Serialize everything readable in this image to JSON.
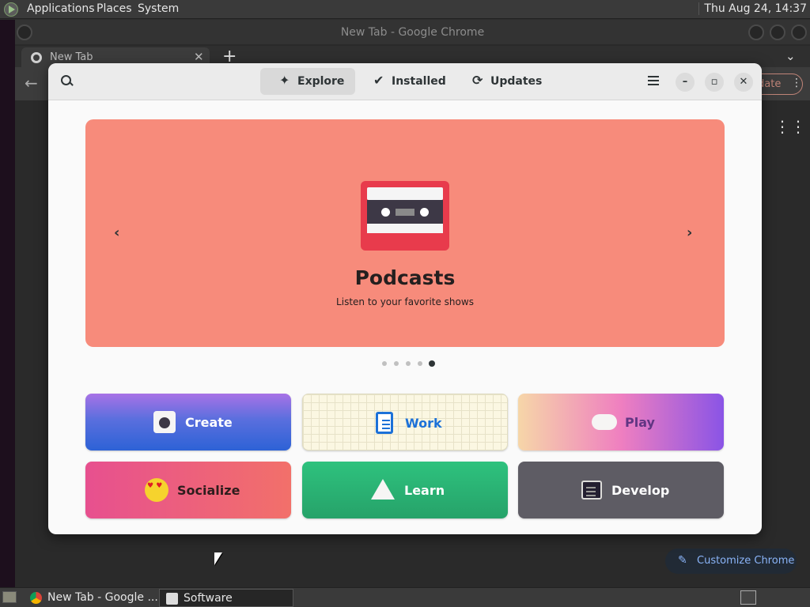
{
  "top_panel": {
    "menus": [
      "Applications",
      "Places",
      "System"
    ],
    "clock": "Thu Aug 24, 14:37"
  },
  "chrome": {
    "window_title": "New Tab - Google Chrome",
    "tab_label": "New Tab",
    "update_label": "date",
    "customize_label": "Customize Chrome"
  },
  "software": {
    "tabs": {
      "explore": "Explore",
      "installed": "Installed",
      "updates": "Updates"
    },
    "hero": {
      "title": "Podcasts",
      "subtitle": "Listen to your favorite shows",
      "page_count": 5,
      "active_page": 5,
      "color": "#f78b7b"
    },
    "categories": {
      "create": "Create",
      "work": "Work",
      "play": "Play",
      "socialize": "Socialize",
      "learn": "Learn",
      "develop": "Develop"
    }
  },
  "taskbar": {
    "items": [
      "New Tab - Google ...",
      "Software"
    ]
  },
  "icons": [
    "search-icon",
    "explore-icon",
    "installed-icon",
    "updates-icon",
    "menu-icon",
    "minimize-icon",
    "maximize-icon",
    "close-icon",
    "chevron-left-icon",
    "chevron-right-icon",
    "cassette-icon",
    "apps-grid-icon",
    "pencil-icon"
  ]
}
